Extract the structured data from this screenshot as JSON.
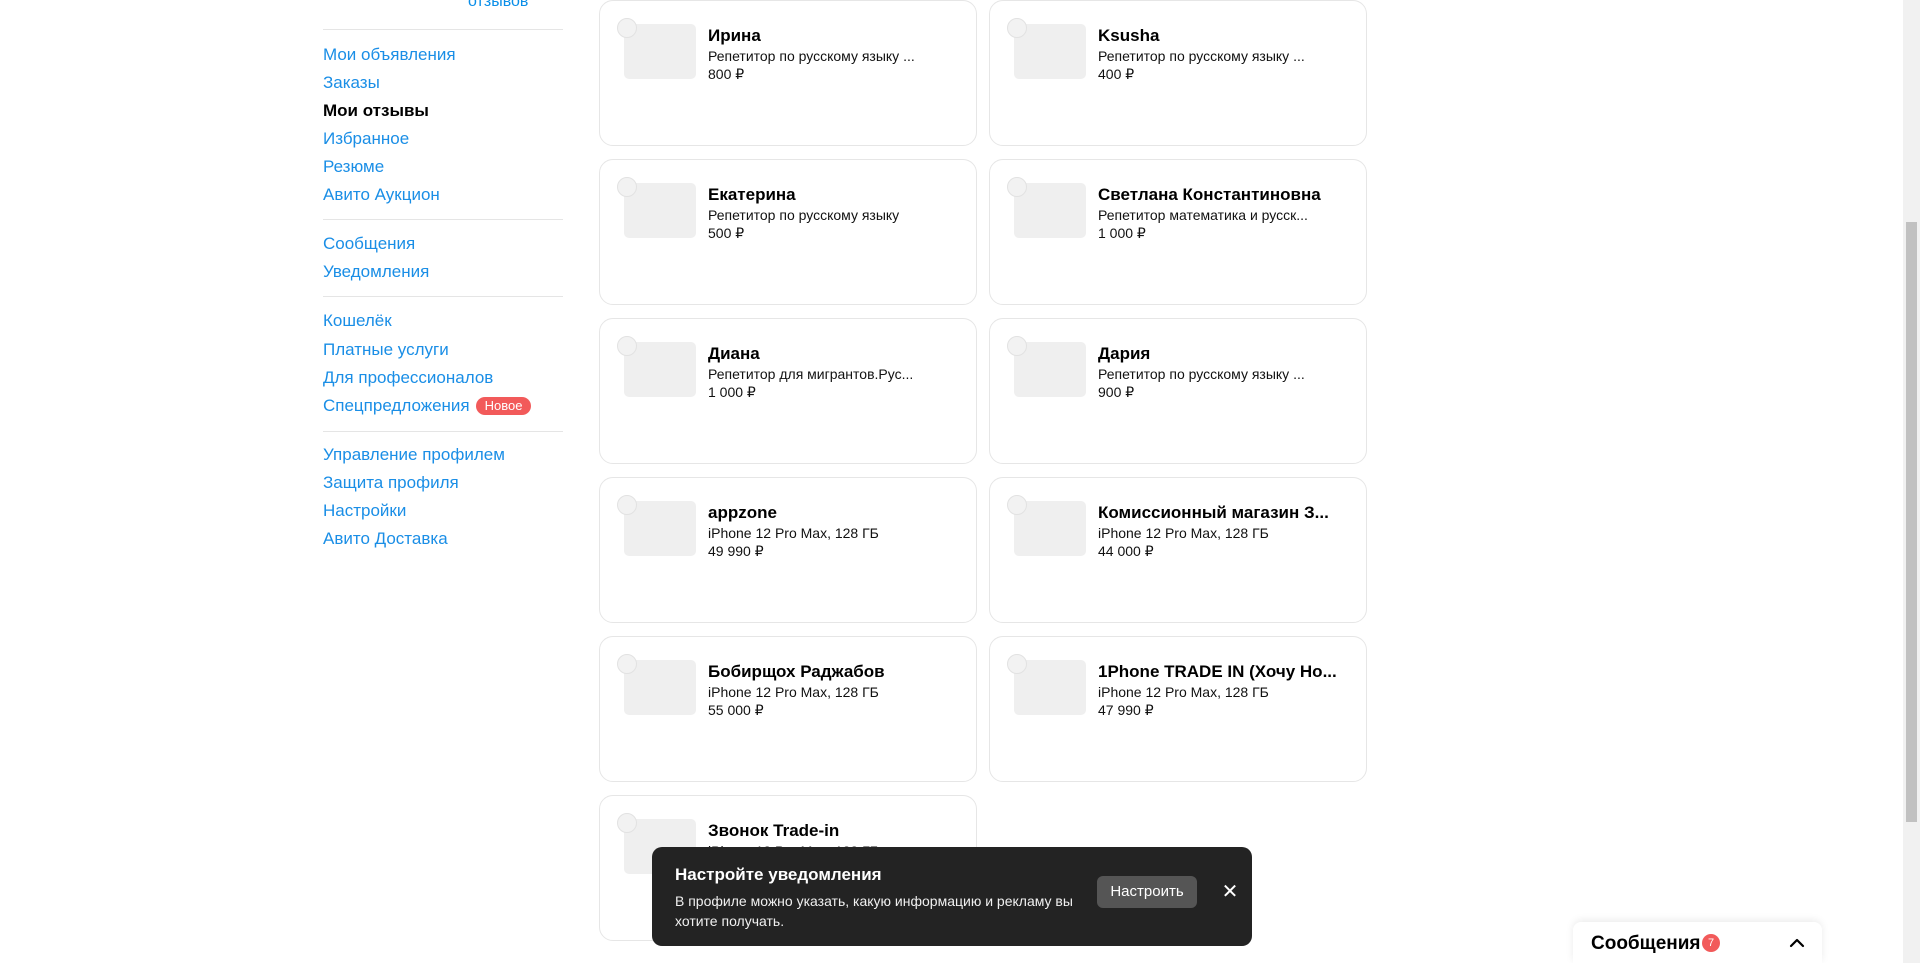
{
  "sidebar": {
    "reviews_link": "отзывов",
    "groups": [
      [
        {
          "label": "Мои объявления",
          "active": false
        },
        {
          "label": "Заказы",
          "active": false
        },
        {
          "label": "Мои отзывы",
          "active": true
        },
        {
          "label": "Избранное",
          "active": false
        },
        {
          "label": "Резюме",
          "active": false
        },
        {
          "label": "Авито Аукцион",
          "active": false
        }
      ],
      [
        {
          "label": "Сообщения",
          "active": false
        },
        {
          "label": "Уведомления",
          "active": false
        }
      ],
      [
        {
          "label": "Кошелёк",
          "active": false
        },
        {
          "label": "Платные услуги",
          "active": false
        },
        {
          "label": "Для профессионалов",
          "active": false
        },
        {
          "label": "Спецпредложения",
          "active": false,
          "badge": "Новое"
        }
      ],
      [
        {
          "label": "Управление профилем",
          "active": false
        },
        {
          "label": "Защита профиля",
          "active": false
        },
        {
          "label": "Настройки",
          "active": false
        },
        {
          "label": "Авито Доставка",
          "active": false
        }
      ]
    ]
  },
  "cards": [
    {
      "name": "Ирина",
      "desc": "Репетитор по русскому языку ...",
      "price": "800 ₽"
    },
    {
      "name": "Ksusha",
      "desc": "Репетитор по русскому языку ...",
      "price": "400 ₽"
    },
    {
      "name": "Екатерина",
      "desc": "Репетитор по русскому языку",
      "price": "500 ₽"
    },
    {
      "name": "Светлана Константиновна",
      "desc": "Репетитор математика и русск...",
      "price": "1 000 ₽"
    },
    {
      "name": "Диана",
      "desc": "Репетитор для мигрантов.Рус...",
      "price": "1 000 ₽"
    },
    {
      "name": "Дария",
      "desc": "Репетитор по русскому языку ...",
      "price": "900 ₽"
    },
    {
      "name": "appzone",
      "desc": "iPhone 12 Pro Max, 128 ГБ",
      "price": "49 990 ₽"
    },
    {
      "name": "Комиссионный магазин З...",
      "desc": "iPhone 12 Pro Max, 128 ГБ",
      "price": "44 000 ₽"
    },
    {
      "name": "Бобирщох Раджабов",
      "desc": "iPhone 12 Pro Max, 128 ГБ",
      "price": "55 000 ₽"
    },
    {
      "name": "1Phone TRADE IN (Хочу Но...",
      "desc": "iPhone 12 Pro Max, 128 ГБ",
      "price": "47 990 ₽"
    },
    {
      "name": "Звонок Trade-in",
      "desc": "iPhone 12 Pro Max, 128 ГБ",
      "price": ""
    }
  ],
  "toast": {
    "title": "Настройте уведомления",
    "text": "В профиле можно указать, какую информацию и рекламу вы хотите получать.",
    "button": "Настроить",
    "close_icon": "close-icon"
  },
  "messages": {
    "label": "Сообщения",
    "count": "7",
    "chevron_icon": "chevron-up-icon"
  },
  "colors": {
    "link": "#1a8ee6",
    "badge": "#f25a5a",
    "toast_bg": "#232323"
  }
}
